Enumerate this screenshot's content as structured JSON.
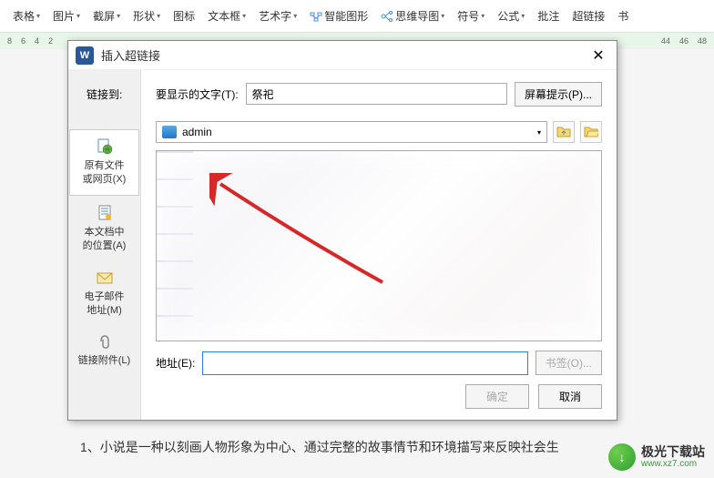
{
  "ribbon": {
    "items": [
      {
        "label": "表格",
        "caret": true
      },
      {
        "label": "图片",
        "caret": true
      },
      {
        "label": "截屏",
        "caret": true
      },
      {
        "label": "形状",
        "caret": true
      },
      {
        "label": "图标"
      },
      {
        "label": "文本框",
        "caret": true
      },
      {
        "label": "艺术字",
        "caret": true
      },
      {
        "label": "智能图形"
      },
      {
        "label": "思维导图",
        "caret": true
      },
      {
        "label": "符号",
        "caret": true
      },
      {
        "label": "公式",
        "caret": true
      },
      {
        "label": "批注"
      },
      {
        "label": "超链接"
      },
      {
        "label": "书"
      }
    ]
  },
  "ruler": {
    "left": [
      "8",
      "6",
      "4",
      "2"
    ],
    "right": [
      "44",
      "46",
      "48"
    ]
  },
  "dialog": {
    "title": "插入超链接",
    "link_to_label": "链接到:",
    "display_label": "要显示的文字(T):",
    "display_value": "祭祀",
    "tooltip_btn": "屏幕提示(P)...",
    "sidebar": {
      "s1": "原有文件\n或网页(X)",
      "s2": "本文档中\n的位置(A)",
      "s3": "电子邮件\n地址(M)",
      "s4": "链接附件(L)"
    },
    "path_current": "admin",
    "addr_label": "地址(E):",
    "bookmark_btn": "书签(O)...",
    "ok_btn": "确定",
    "cancel_btn": "取消"
  },
  "document": {
    "para1": "1、小说是一种以刻画人物形象为中心、通过完整的故事情节和环境描写来反映社会生"
  },
  "watermark": {
    "cn": "极光下载站",
    "url": "www.xz7.com"
  }
}
